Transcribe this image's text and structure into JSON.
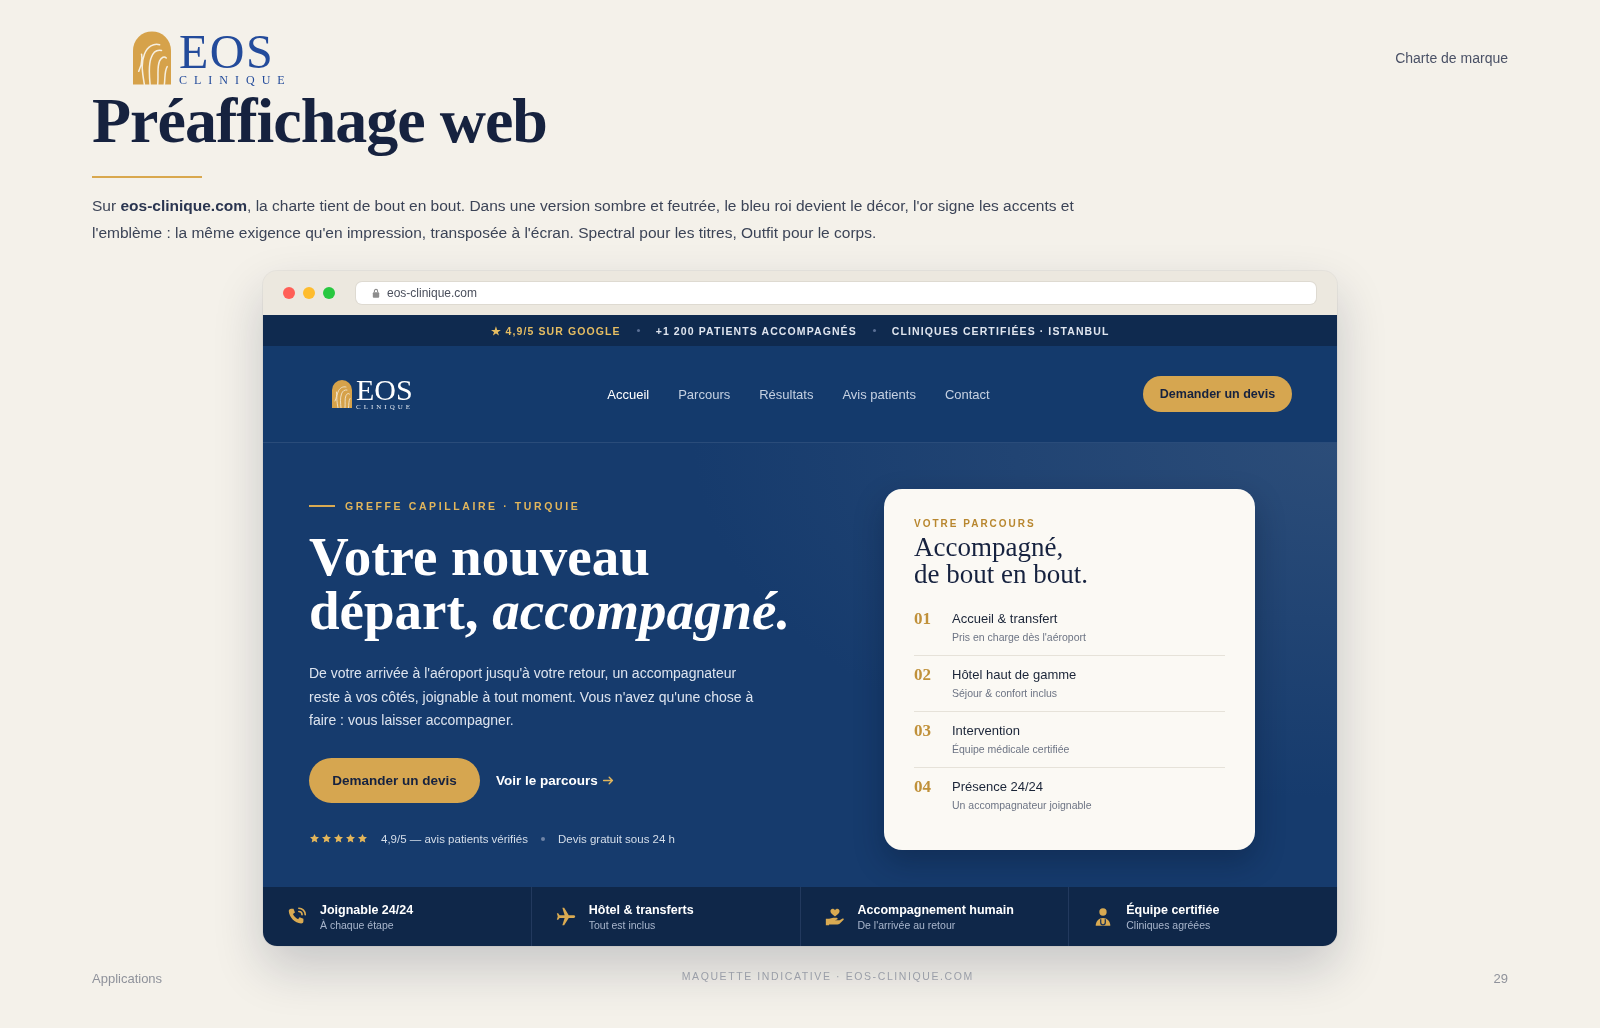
{
  "slide": {
    "logo": {
      "name": "EOS",
      "tagline": "CLINIQUE"
    },
    "section": "Charte de marque",
    "title": "Préaffichage web",
    "intro": "Sur **eos-clinique.com**, la charte tient de bout en bout. Dans une version sombre et feutrée, le bleu roi devient le décor, l'or signe les accents et l'emblème : la même exigence qu'en impression, transposée à l'écran. Spectral pour les titres, Outfit pour le corps."
  },
  "browser": {
    "dots": [
      {
        "color": "#ff5f57"
      },
      {
        "color": "#febc2e"
      },
      {
        "color": "#28c840"
      }
    ],
    "url": "eos-clinique.com"
  },
  "site": {
    "announcements": [
      {
        "text": "★ 4,9/5 SUR GOOGLE",
        "highlight": true
      },
      {
        "text": "+1 200 PATIENTS ACCOMPAGNÉS",
        "highlight": false
      },
      {
        "text": "CLINIQUES CERTIFIÉES · ISTANBUL",
        "highlight": false
      }
    ],
    "nav": {
      "logo": {
        "name": "EOS",
        "tagline": "CLINIQUE"
      },
      "links": [
        {
          "label": "Accueil",
          "selected": true
        },
        {
          "label": "Parcours",
          "selected": false
        },
        {
          "label": "Résultats",
          "selected": false
        },
        {
          "label": "Avis patients",
          "selected": false
        },
        {
          "label": "Contact",
          "selected": false
        }
      ],
      "cta": "Demander un devis"
    },
    "hero": {
      "eyebrow": "GREFFE CAPILLAIRE · TURQUIE",
      "title": "Votre nouveau départ, *accompagné.*",
      "text": "De votre arrivée à l'aéroport jusqu'à votre retour, un accompagnateur reste à vos côtés, joignable à tout moment. Vous n'avez qu'une chose à faire : vous laisser accompagner.",
      "cta": "Demander un devis",
      "link": "Voir le parcours",
      "rating": {
        "stars": 5,
        "text": "4,9/5 — avis patients vérifiés"
      },
      "note": "Devis gratuit sous 24 h"
    },
    "journey_card": {
      "eyebrow": "VOTRE PARCOURS",
      "title": "Accompagné, de bout en bout.",
      "steps": [
        {
          "number": "01",
          "title": "Accueil & transfert",
          "subtitle": "Pris en charge dès l'aéroport"
        },
        {
          "number": "02",
          "title": "Hôtel haut de gamme",
          "subtitle": "Séjour & confort inclus"
        },
        {
          "number": "03",
          "title": "Intervention",
          "subtitle": "Équipe médicale certifiée"
        },
        {
          "number": "04",
          "title": "Présence 24/24",
          "subtitle": "Un accompagnateur joignable"
        }
      ]
    },
    "features": [
      {
        "kind": "phone",
        "title": "Joignable 24/24",
        "subtitle": "À chaque étape"
      },
      {
        "kind": "plane",
        "title": "Hôtel & transferts",
        "subtitle": "Tout est inclus"
      },
      {
        "kind": "care",
        "title": "Accompagnement humain",
        "subtitle": "De l'arrivée au retour"
      },
      {
        "kind": "staff",
        "title": "Équipe certifiée",
        "subtitle": "Cliniques agréées"
      }
    ]
  },
  "footer": {
    "section": "Applications",
    "caption": "MAQUETTE INDICATIVE · EOS-CLINIQUE.COM",
    "page_number": "29"
  }
}
